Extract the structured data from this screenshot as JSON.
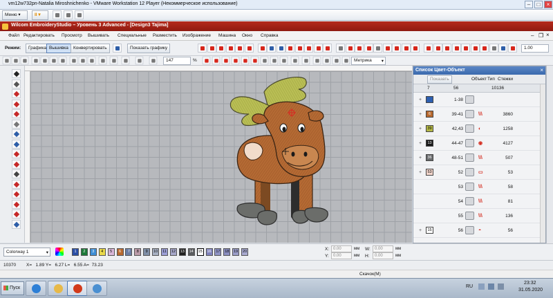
{
  "vm_window": {
    "title": "vm12w732pn-Natalia Miroshnichenko - VMware Workstation 12 Player (Некоммерческое использование)",
    "menu_label": "Меню",
    "pause_label": "II"
  },
  "app": {
    "title": "Wilcom EmbroideryStudio – Уровень 3 Advanced - [Design3       Tajima]"
  },
  "menu": [
    "Файл",
    "Редактировать",
    "Просмотр",
    "Вышивать",
    "Специальные",
    "Разместить",
    "Изображение",
    "Машина",
    "Окно",
    "Справка"
  ],
  "toolbar": {
    "mode_label": "Режим:",
    "graphics_tab": "Графика",
    "embroidery_tab": "Вышивка",
    "convert_button": "Конвертировать",
    "show_graphics_button": "Показать графику",
    "zoom_value": "1.00"
  },
  "toolbar2": {
    "stitch_count_value": "147",
    "percent_sign": "%",
    "units_select": "Метрика"
  },
  "colors": {
    "accent": "#b52a1c",
    "panel_title": "#3a69ad"
  },
  "panel": {
    "title": "Список Цвет-Объект",
    "show_button": "Показать",
    "col_objects": "Объект",
    "col_type": "Тип",
    "col_stitches": "Стежки",
    "summary_colors": "7",
    "summary_objects": "56",
    "summary_stitches": "10136",
    "rows": [
      {
        "swatch": "",
        "swatch_color": "#2d5fb0",
        "range": "1-38",
        "stitches": "",
        "type": ""
      },
      {
        "swatch": "6",
        "swatch_color": "#b8692f",
        "range": "39-41",
        "stitches": "3860",
        "type": "\\\\\\"
      },
      {
        "swatch": "39",
        "swatch_color": "#b4b845",
        "range": "42,43",
        "stitches": "1258",
        "type": "◐"
      },
      {
        "swatch": "13",
        "swatch_color": "#1a1a1a",
        "range": "44-47",
        "stitches": "4127",
        "type": "◉"
      },
      {
        "swatch": "36",
        "swatch_color": "#6a6c6e",
        "range": "48-51",
        "stitches": "507",
        "type": "\\\\\\"
      },
      {
        "swatch": "53",
        "swatch_color": "#f3d6cc",
        "range": "52",
        "stitches": "53",
        "type": "▭"
      },
      {
        "swatch": "",
        "swatch_color": "",
        "range": "53",
        "stitches": "58",
        "type": "\\\\\\"
      },
      {
        "swatch": "",
        "swatch_color": "",
        "range": "54",
        "stitches": "81",
        "type": "\\\\\\"
      },
      {
        "swatch": "",
        "swatch_color": "",
        "range": "55",
        "stitches": "136",
        "type": "\\\\\\"
      },
      {
        "swatch": "15",
        "swatch_color": "#ffffff",
        "range": "56",
        "stitches": "56",
        "type": "◓"
      }
    ]
  },
  "colorbar": {
    "colorway_select": "Colorway 1",
    "swatches": [
      {
        "label": "1",
        "color": "#2b4fa6"
      },
      {
        "label": "2",
        "color": "#1e7a3a"
      },
      {
        "label": "3",
        "color": "#3f8fd6"
      },
      {
        "label": "4",
        "color": "#e8d84b"
      },
      {
        "label": "5",
        "color": "#d8b6d8"
      },
      {
        "label": "6",
        "color": "#b8692f"
      },
      {
        "label": "7",
        "color": "#6b7ea6"
      },
      {
        "label": "8",
        "color": "#b99aa8"
      },
      {
        "label": "9",
        "color": "#7f8fa7"
      },
      {
        "label": "10",
        "color": "#a7b0c2"
      },
      {
        "label": "11",
        "color": "#9c9fd6"
      },
      {
        "label": "12",
        "color": "#a6a7c9"
      },
      {
        "label": "13",
        "color": "#222222"
      },
      {
        "label": "14",
        "color": "#5b5d60"
      },
      {
        "label": "15",
        "color": "#ffffff"
      },
      {
        "label": "16",
        "color": "#7f82bc"
      },
      {
        "label": "17",
        "color": "#8f93c4"
      },
      {
        "label": "18",
        "color": "#8a8ec0"
      },
      {
        "label": "19",
        "color": "#9a9dc8"
      },
      {
        "label": "20",
        "color": "#a7a9cf"
      }
    ],
    "x_value": "0.00",
    "y_value": "0.00",
    "w_value": "0.00",
    "h_value": "0.00",
    "unit": "мм",
    "x_label": "X:",
    "y_label": "Y:",
    "w_label": "W:",
    "h_label": "H:"
  },
  "status": {
    "stitches": "10370",
    "coords": "X=   1.89 Y=   6.27 L=   6.55 A=  73.23",
    "jump_label": "Скачок(М)"
  },
  "taskbar": {
    "start_label": "Пуск",
    "language": "RU",
    "time": "23:32",
    "date": "31.05.2020"
  }
}
